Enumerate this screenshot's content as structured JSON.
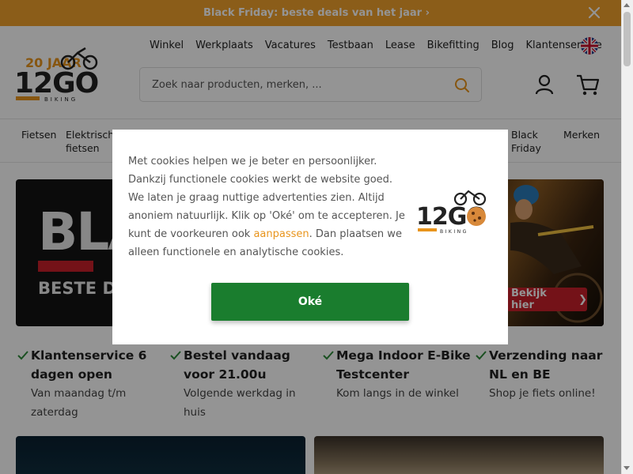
{
  "banner": {
    "text": "Black Friday: beste deals van het jaar ›",
    "background": "#f0a02c"
  },
  "header": {
    "logo": {
      "main": "12GO",
      "sub": "BIKING",
      "anniversary": "20 JAAR",
      "accent": "#e8941c"
    },
    "topnav": [
      "Winkel",
      "Werkplaats",
      "Vacatures",
      "Testbaan",
      "Lease",
      "Bikefitting",
      "Blog",
      "Klantenservice"
    ],
    "language_flag": "uk-flag-icon",
    "search": {
      "placeholder": "Zoek naar producten, merken, ..."
    }
  },
  "catnav": {
    "items": [
      {
        "label": "Fietsen"
      },
      {
        "label": "Elektrische fietsen"
      },
      {
        "label": "Black Friday"
      },
      {
        "label": "Merken"
      }
    ]
  },
  "hero": {
    "headline_fragment": "BLA",
    "subline_fragment": "BESTE D",
    "cta": "Bekijk hier",
    "accent": "#c9202a"
  },
  "usps": [
    {
      "title": "Klantenservice 6 dagen open",
      "sub": "Van maandag t/m zaterdag"
    },
    {
      "title": "Bestel vandaag voor 21.00u",
      "sub": "Volgende werkdag in huis"
    },
    {
      "title": "Mega Indoor E-Bike Testcenter",
      "sub": "Kom langs in de winkel"
    },
    {
      "title": "Verzending naar NL en BE",
      "sub": "Shop je fiets online!"
    }
  ],
  "cookie": {
    "text_before": "Met cookies helpen we je beter en persoonlijker. Dankzij functionele cookies werkt de website goed. We laten je graag nuttige advertenties zien. Altijd anoniem natuurlijk. Klik op 'Oké' om te accepteren. Je kunt de voorkeuren ook ",
    "link": "aanpassen",
    "text_after": ". Dan plaatsen we alleen functionele en analytische cookies.",
    "ok": "Oké",
    "ok_color": "#1a7d2e"
  }
}
